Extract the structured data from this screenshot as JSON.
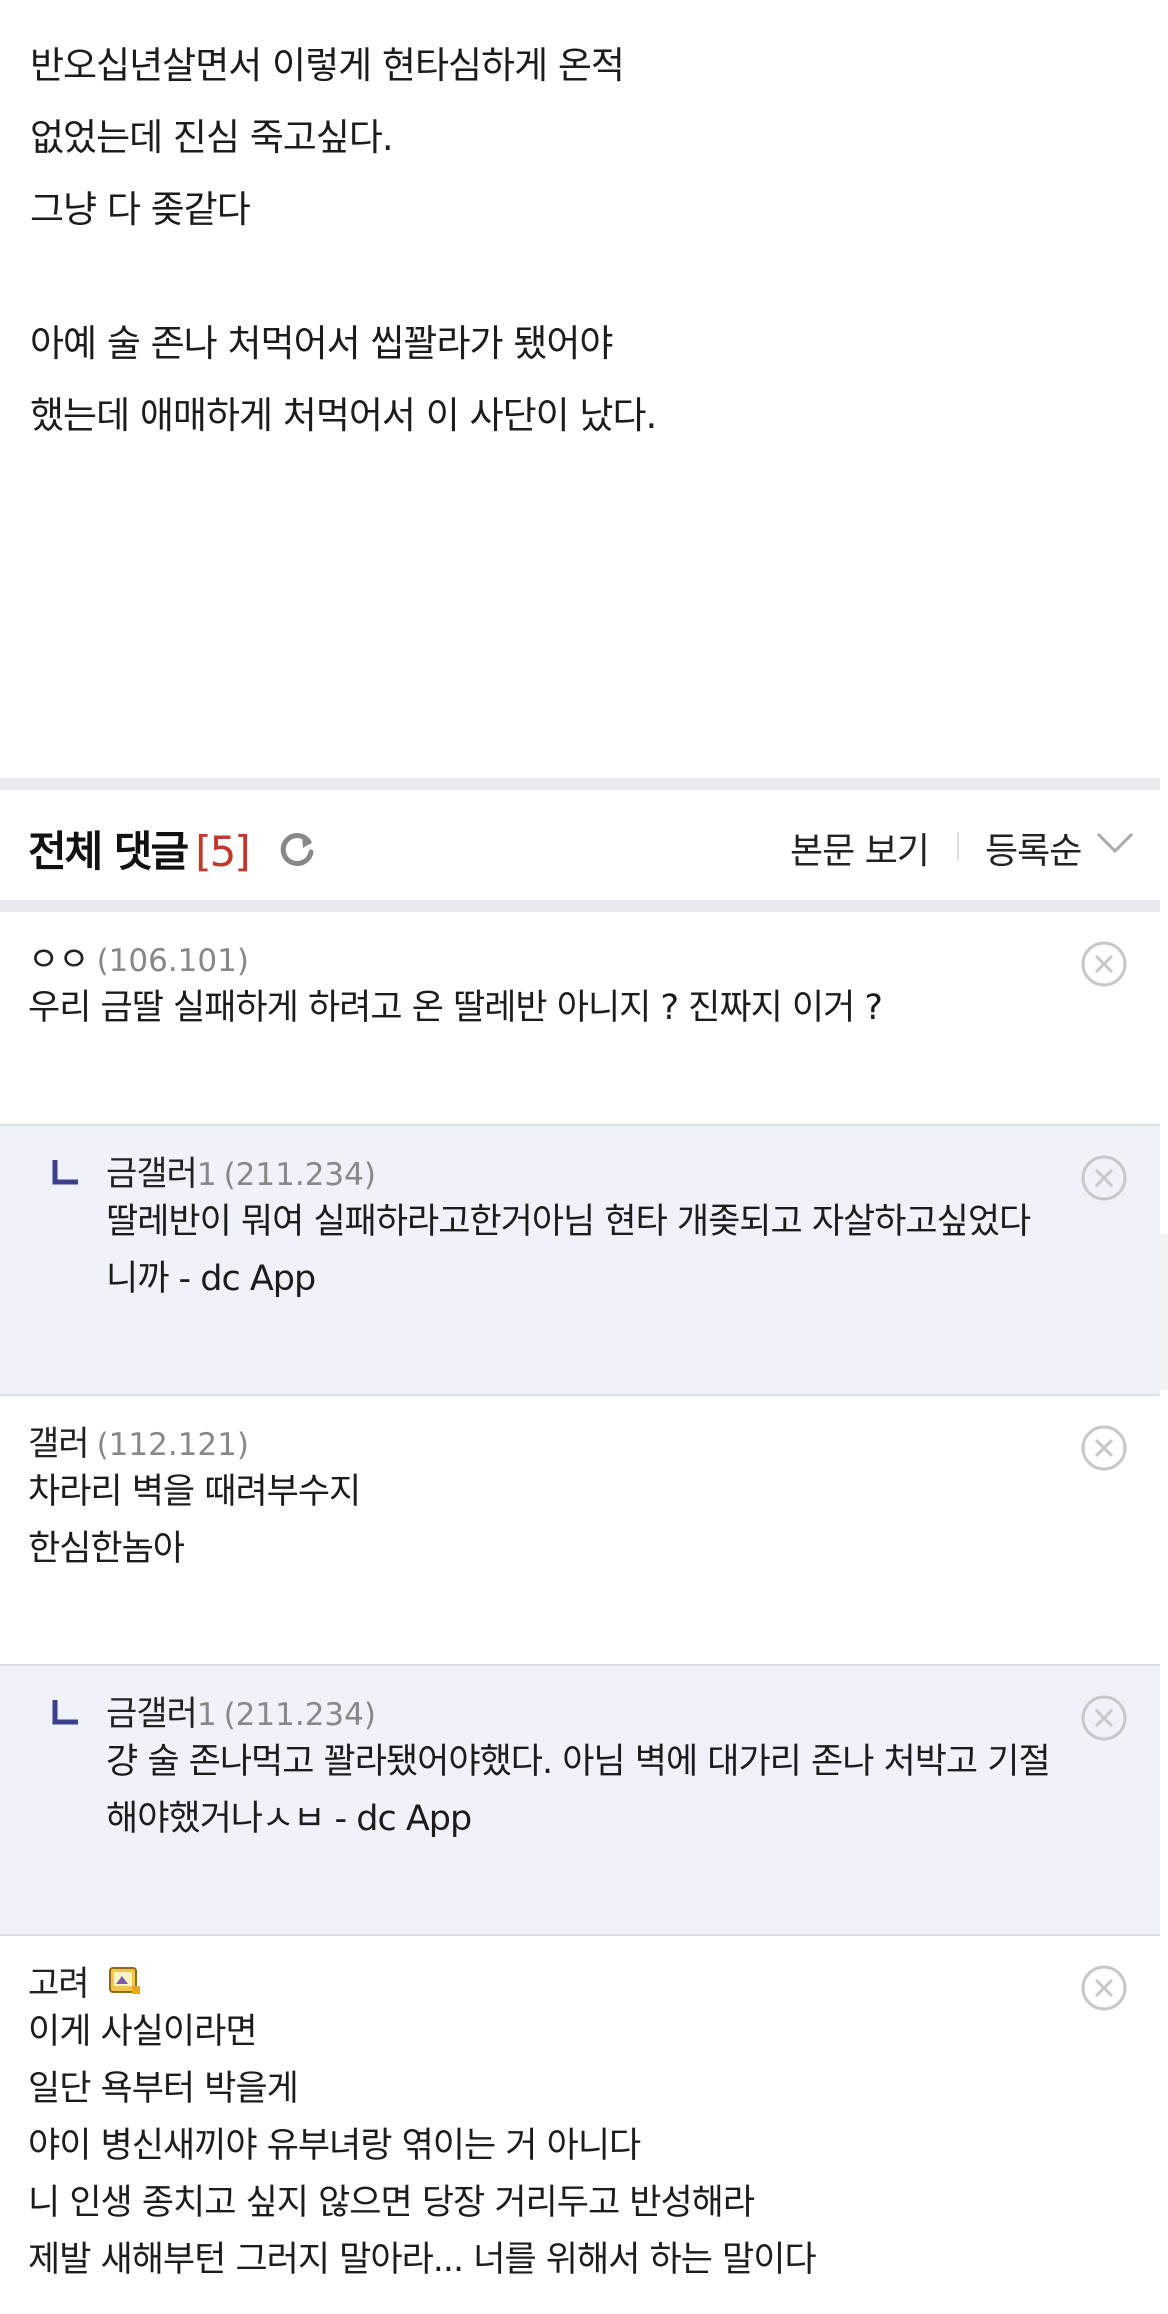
{
  "post": {
    "lines": [
      "반오십년살면서 이렇게 현타심하게 온적",
      "없었는데 진심 죽고싶다.",
      "그냥 다 좆같다",
      "",
      "아예 술 존나 처먹어서 씹꽐라가 됐어야",
      "했는데 애매하게 처먹어서 이 사단이 났다."
    ]
  },
  "comments_header": {
    "title": "전체 댓글",
    "count": "[5]",
    "view_body": "본문 보기",
    "sort": "등록순"
  },
  "comments": [
    {
      "author": "ㅇㅇ",
      "ip": "(106.101)",
      "lines": [
        "우리 금딸 실패하게 하려고 온 딸레반 아니지 ? 진짜지 이거 ?"
      ]
    },
    {
      "author": "금갤러",
      "badge": "1",
      "ip": "(211.234)",
      "lines": [
        "딸레반이 뭐여 실패하라고한거아님 현타 개좆되고 자살하고싶었다",
        "니까 - dc App"
      ]
    },
    {
      "author": "갤러",
      "ip": "(112.121)",
      "lines": [
        "차라리 벽을 때려부수지",
        "한심한놈아"
      ]
    },
    {
      "author": "금갤러",
      "badge": "1",
      "ip": "(211.234)",
      "lines": [
        "걍 술 존나먹고 꽐라됐어야했다. 아님 벽에 대가리 존나 처박고 기절",
        "해야했거나ㅅㅂ - dc App"
      ]
    },
    {
      "author": "고려",
      "lines": [
        "이게 사실이라면",
        "일단 욕부터 박을게",
        "야이 병신새끼야 유부녀랑 엮이는 거 아니다",
        "니 인생 종치고 싶지 않으면 당장 거리두고 반성해라",
        "제발 새해부턴 그러지 말아라... 너를 위해서 하는 말이다"
      ]
    }
  ],
  "colors": {
    "count_red": "#c0392b",
    "reply_bg": "#eff2f8",
    "reply_arrow": "#3b3f8c",
    "separator": "#e9e9ee"
  },
  "icons": {
    "refresh": "refresh-icon",
    "sort_chevron": "chevron-down-icon",
    "delete": "close-circle-icon",
    "reply": "reply-arrow-icon",
    "gallery_badge": "gallery-badge-icon"
  }
}
